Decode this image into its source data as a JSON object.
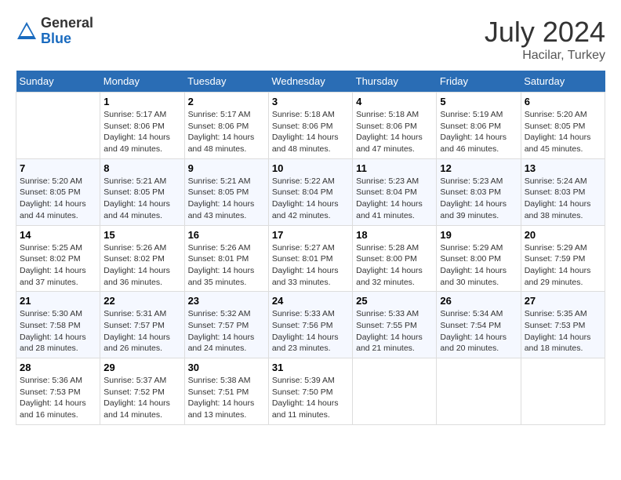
{
  "header": {
    "logo_general": "General",
    "logo_blue": "Blue",
    "month_year": "July 2024",
    "location": "Hacilar, Turkey"
  },
  "weekdays": [
    "Sunday",
    "Monday",
    "Tuesday",
    "Wednesday",
    "Thursday",
    "Friday",
    "Saturday"
  ],
  "weeks": [
    [
      {
        "day": "",
        "sunrise": "",
        "sunset": "",
        "daylight": ""
      },
      {
        "day": "1",
        "sunrise": "Sunrise: 5:17 AM",
        "sunset": "Sunset: 8:06 PM",
        "daylight": "Daylight: 14 hours and 49 minutes."
      },
      {
        "day": "2",
        "sunrise": "Sunrise: 5:17 AM",
        "sunset": "Sunset: 8:06 PM",
        "daylight": "Daylight: 14 hours and 48 minutes."
      },
      {
        "day": "3",
        "sunrise": "Sunrise: 5:18 AM",
        "sunset": "Sunset: 8:06 PM",
        "daylight": "Daylight: 14 hours and 48 minutes."
      },
      {
        "day": "4",
        "sunrise": "Sunrise: 5:18 AM",
        "sunset": "Sunset: 8:06 PM",
        "daylight": "Daylight: 14 hours and 47 minutes."
      },
      {
        "day": "5",
        "sunrise": "Sunrise: 5:19 AM",
        "sunset": "Sunset: 8:06 PM",
        "daylight": "Daylight: 14 hours and 46 minutes."
      },
      {
        "day": "6",
        "sunrise": "Sunrise: 5:20 AM",
        "sunset": "Sunset: 8:05 PM",
        "daylight": "Daylight: 14 hours and 45 minutes."
      }
    ],
    [
      {
        "day": "7",
        "sunrise": "Sunrise: 5:20 AM",
        "sunset": "Sunset: 8:05 PM",
        "daylight": "Daylight: 14 hours and 44 minutes."
      },
      {
        "day": "8",
        "sunrise": "Sunrise: 5:21 AM",
        "sunset": "Sunset: 8:05 PM",
        "daylight": "Daylight: 14 hours and 44 minutes."
      },
      {
        "day": "9",
        "sunrise": "Sunrise: 5:21 AM",
        "sunset": "Sunset: 8:05 PM",
        "daylight": "Daylight: 14 hours and 43 minutes."
      },
      {
        "day": "10",
        "sunrise": "Sunrise: 5:22 AM",
        "sunset": "Sunset: 8:04 PM",
        "daylight": "Daylight: 14 hours and 42 minutes."
      },
      {
        "day": "11",
        "sunrise": "Sunrise: 5:23 AM",
        "sunset": "Sunset: 8:04 PM",
        "daylight": "Daylight: 14 hours and 41 minutes."
      },
      {
        "day": "12",
        "sunrise": "Sunrise: 5:23 AM",
        "sunset": "Sunset: 8:03 PM",
        "daylight": "Daylight: 14 hours and 39 minutes."
      },
      {
        "day": "13",
        "sunrise": "Sunrise: 5:24 AM",
        "sunset": "Sunset: 8:03 PM",
        "daylight": "Daylight: 14 hours and 38 minutes."
      }
    ],
    [
      {
        "day": "14",
        "sunrise": "Sunrise: 5:25 AM",
        "sunset": "Sunset: 8:02 PM",
        "daylight": "Daylight: 14 hours and 37 minutes."
      },
      {
        "day": "15",
        "sunrise": "Sunrise: 5:26 AM",
        "sunset": "Sunset: 8:02 PM",
        "daylight": "Daylight: 14 hours and 36 minutes."
      },
      {
        "day": "16",
        "sunrise": "Sunrise: 5:26 AM",
        "sunset": "Sunset: 8:01 PM",
        "daylight": "Daylight: 14 hours and 35 minutes."
      },
      {
        "day": "17",
        "sunrise": "Sunrise: 5:27 AM",
        "sunset": "Sunset: 8:01 PM",
        "daylight": "Daylight: 14 hours and 33 minutes."
      },
      {
        "day": "18",
        "sunrise": "Sunrise: 5:28 AM",
        "sunset": "Sunset: 8:00 PM",
        "daylight": "Daylight: 14 hours and 32 minutes."
      },
      {
        "day": "19",
        "sunrise": "Sunrise: 5:29 AM",
        "sunset": "Sunset: 8:00 PM",
        "daylight": "Daylight: 14 hours and 30 minutes."
      },
      {
        "day": "20",
        "sunrise": "Sunrise: 5:29 AM",
        "sunset": "Sunset: 7:59 PM",
        "daylight": "Daylight: 14 hours and 29 minutes."
      }
    ],
    [
      {
        "day": "21",
        "sunrise": "Sunrise: 5:30 AM",
        "sunset": "Sunset: 7:58 PM",
        "daylight": "Daylight: 14 hours and 28 minutes."
      },
      {
        "day": "22",
        "sunrise": "Sunrise: 5:31 AM",
        "sunset": "Sunset: 7:57 PM",
        "daylight": "Daylight: 14 hours and 26 minutes."
      },
      {
        "day": "23",
        "sunrise": "Sunrise: 5:32 AM",
        "sunset": "Sunset: 7:57 PM",
        "daylight": "Daylight: 14 hours and 24 minutes."
      },
      {
        "day": "24",
        "sunrise": "Sunrise: 5:33 AM",
        "sunset": "Sunset: 7:56 PM",
        "daylight": "Daylight: 14 hours and 23 minutes."
      },
      {
        "day": "25",
        "sunrise": "Sunrise: 5:33 AM",
        "sunset": "Sunset: 7:55 PM",
        "daylight": "Daylight: 14 hours and 21 minutes."
      },
      {
        "day": "26",
        "sunrise": "Sunrise: 5:34 AM",
        "sunset": "Sunset: 7:54 PM",
        "daylight": "Daylight: 14 hours and 20 minutes."
      },
      {
        "day": "27",
        "sunrise": "Sunrise: 5:35 AM",
        "sunset": "Sunset: 7:53 PM",
        "daylight": "Daylight: 14 hours and 18 minutes."
      }
    ],
    [
      {
        "day": "28",
        "sunrise": "Sunrise: 5:36 AM",
        "sunset": "Sunset: 7:53 PM",
        "daylight": "Daylight: 14 hours and 16 minutes."
      },
      {
        "day": "29",
        "sunrise": "Sunrise: 5:37 AM",
        "sunset": "Sunset: 7:52 PM",
        "daylight": "Daylight: 14 hours and 14 minutes."
      },
      {
        "day": "30",
        "sunrise": "Sunrise: 5:38 AM",
        "sunset": "Sunset: 7:51 PM",
        "daylight": "Daylight: 14 hours and 13 minutes."
      },
      {
        "day": "31",
        "sunrise": "Sunrise: 5:39 AM",
        "sunset": "Sunset: 7:50 PM",
        "daylight": "Daylight: 14 hours and 11 minutes."
      },
      {
        "day": "",
        "sunrise": "",
        "sunset": "",
        "daylight": ""
      },
      {
        "day": "",
        "sunrise": "",
        "sunset": "",
        "daylight": ""
      },
      {
        "day": "",
        "sunrise": "",
        "sunset": "",
        "daylight": ""
      }
    ]
  ]
}
